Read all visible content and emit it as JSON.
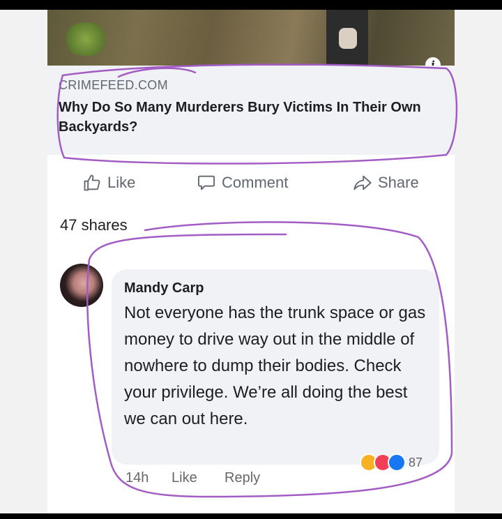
{
  "link_preview": {
    "domain": "CRIMEFEED.COM",
    "headline": "Why Do So Many Murderers Bury Victims In Their Own Backyards?",
    "info_icon_glyph": "i"
  },
  "actions": {
    "like_label": "Like",
    "comment_label": "Comment",
    "share_label": "Share"
  },
  "shares_text": "47 shares",
  "comment": {
    "author": "Mandy Carp",
    "text": "Not everyone has the trunk space or gas money to drive way out in the middle of nowhere to dump their bodies. Check your privilege. We’re all doing the best we can out here.",
    "time": "14h",
    "like_label": "Like",
    "reply_label": "Reply",
    "reaction_count": "87",
    "reactions": [
      "haha",
      "love",
      "like"
    ]
  },
  "colors": {
    "annotation": "#a25cc4",
    "secondary_text": "#606770",
    "bubble_bg": "#f0f2f5",
    "reaction_like": "#1877f2",
    "reaction_love": "#f33e58",
    "reaction_haha": "#f7b125"
  }
}
